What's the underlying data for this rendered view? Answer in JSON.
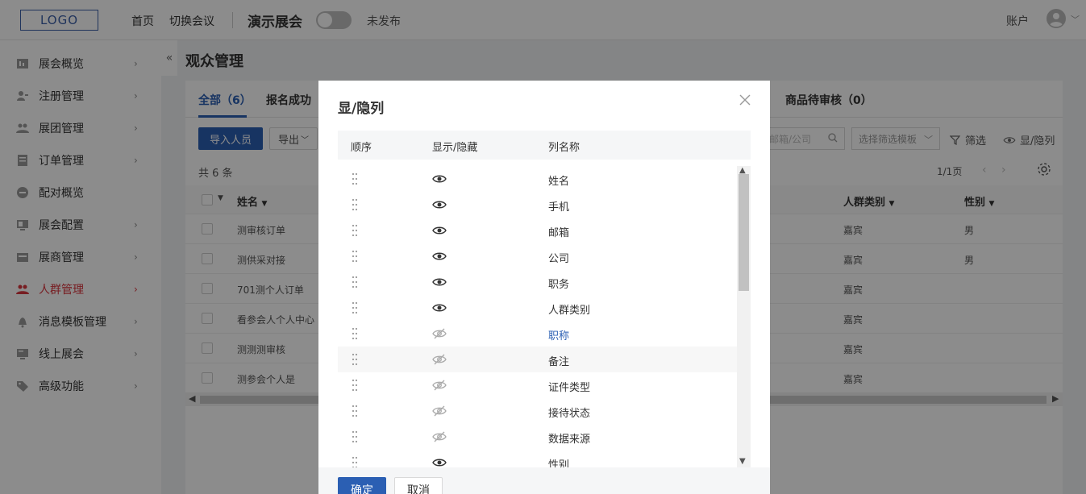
{
  "header": {
    "logo": "LOGO",
    "nav": [
      "首页",
      "切换会议"
    ],
    "expo_name": "演示展会",
    "publish_status": "未发布",
    "account": "账户"
  },
  "sidebar": {
    "collapse": "«",
    "arrow": "›",
    "items": [
      {
        "label": "展会概览",
        "icon": "overview-icon",
        "has_arrow": true
      },
      {
        "label": "注册管理",
        "icon": "registration-icon",
        "has_arrow": true
      },
      {
        "label": "展团管理",
        "icon": "delegation-icon",
        "has_arrow": true
      },
      {
        "label": "订单管理",
        "icon": "order-icon",
        "has_arrow": true
      },
      {
        "label": "配对概览",
        "icon": "matching-icon",
        "has_arrow": false
      },
      {
        "label": "展会配置",
        "icon": "config-icon",
        "has_arrow": true
      },
      {
        "label": "展商管理",
        "icon": "exhibitor-icon",
        "has_arrow": true
      },
      {
        "label": "人群管理",
        "icon": "people-icon",
        "has_arrow": true,
        "active": true
      },
      {
        "label": "消息模板管理",
        "icon": "bell-icon",
        "has_arrow": true
      },
      {
        "label": "线上展会",
        "icon": "monitor-icon",
        "has_arrow": true
      },
      {
        "label": "高级功能",
        "icon": "tag-icon",
        "has_arrow": true
      }
    ],
    "active_color": "#d9363e"
  },
  "main": {
    "title": "观众管理",
    "tabs": [
      "全部（6）",
      "报名成功（",
      "商品待审核（0）"
    ],
    "import_button": "导入人员",
    "export_button": "导出",
    "search_placeholder": "邮箱/公司",
    "filter_template_placeholder": "选择筛选模板",
    "filter_label": "筛选",
    "columns_label": "显/隐列",
    "total": "共 6 条",
    "pager": "1/1页",
    "table": {
      "headers": {
        "name": "姓名",
        "group": "人群类别",
        "gender": "性别"
      },
      "rows": [
        {
          "name": "测审核订单",
          "group": "嘉宾",
          "gender": "男"
        },
        {
          "name": "测供采对接",
          "group": "嘉宾",
          "gender": "男"
        },
        {
          "name": "701测个人订单",
          "group": "嘉宾",
          "gender": ""
        },
        {
          "name": "看参会人个人中心",
          "group": "嘉宾",
          "gender": ""
        },
        {
          "name": "测测测审核",
          "group": "嘉宾",
          "gender": ""
        },
        {
          "name": "测参会个人是",
          "group": "嘉宾",
          "gender": ""
        }
      ]
    }
  },
  "modal": {
    "title": "显/隐列",
    "headers": {
      "order": "顺序",
      "visibility": "显示/隐藏",
      "name": "列名称"
    },
    "columns": [
      {
        "name": "姓名",
        "visible": true
      },
      {
        "name": "手机",
        "visible": true
      },
      {
        "name": "邮箱",
        "visible": true
      },
      {
        "name": "公司",
        "visible": true
      },
      {
        "name": "职务",
        "visible": true
      },
      {
        "name": "人群类别",
        "visible": true
      },
      {
        "name": "职称",
        "visible": false,
        "highlight": true
      },
      {
        "name": "备注",
        "visible": false,
        "hover": true
      },
      {
        "name": "证件类型",
        "visible": false
      },
      {
        "name": "接待状态",
        "visible": false
      },
      {
        "name": "数据来源",
        "visible": false
      },
      {
        "name": "性别",
        "visible": true
      }
    ],
    "ok_button": "确定",
    "cancel_button": "取消"
  },
  "colors": {
    "primary": "#2b5fb3",
    "overlay": "rgba(0,0,0,0.45)"
  }
}
